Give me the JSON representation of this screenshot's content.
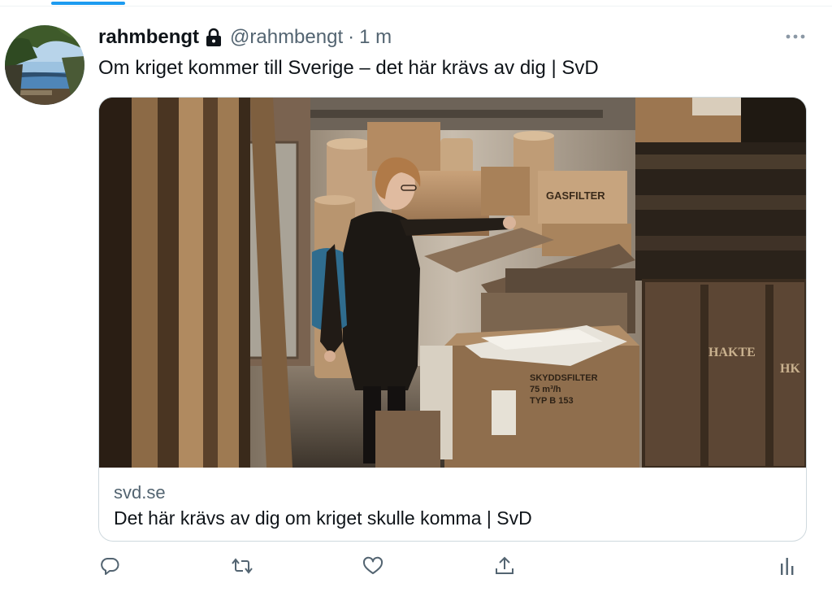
{
  "tweet": {
    "display_name": "rahmbengt",
    "protected_icon": "lock-icon",
    "handle": "@rahmbengt",
    "separator": "·",
    "time": "1 m",
    "text": "Om kriget kommer till Sverige – det här krävs av dig | SvD"
  },
  "card": {
    "domain": "svd.se",
    "title": "Det här krävs av dig om kriget skulle komma | SvD",
    "photo_text": {
      "box_label_1": "GASFILTER",
      "box_label_2": "SKYDDSFILTER",
      "box_label_3": "75 m³/h",
      "box_label_4": "TYP B 153",
      "crate_label_1": "HAKTE",
      "crate_label_2": "HK"
    }
  },
  "actions": {
    "reply_icon": "reply-icon",
    "retweet_icon": "retweet-icon",
    "like_icon": "heart-icon",
    "share_icon": "share-icon",
    "analytics_icon": "analytics-icon"
  },
  "colors": {
    "accent": "#1d9bf0",
    "secondary_text": "#536471",
    "border": "#cfd9de"
  }
}
